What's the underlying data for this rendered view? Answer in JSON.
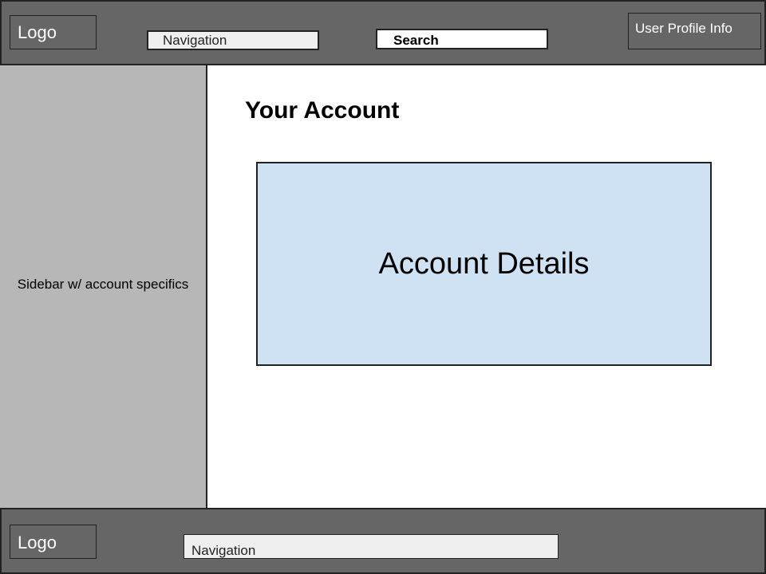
{
  "header": {
    "logo": "Logo",
    "navigation": "Navigation",
    "search": "Search",
    "user_profile": "User Profile Info"
  },
  "sidebar": {
    "label": "Sidebar w/ account specifics"
  },
  "main": {
    "title": "Your Account",
    "details_label": "Account Details"
  },
  "footer": {
    "logo": "Logo",
    "navigation": "Navigation"
  },
  "colors": {
    "header_footer_bg": "#666666",
    "sidebar_bg": "#b7b7b7",
    "details_bg": "#cfe2f3",
    "nav_bg": "#efefef",
    "border": "#222222"
  }
}
